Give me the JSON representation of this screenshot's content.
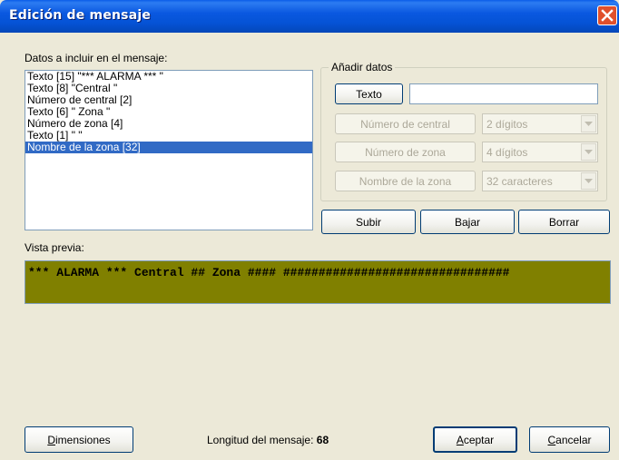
{
  "window": {
    "title": "Edición de mensaje"
  },
  "list": {
    "label": "Datos a incluir en el mensaje:",
    "items": [
      {
        "text": "Texto [15] \"*** ALARMA *** \"",
        "selected": false
      },
      {
        "text": "Texto [8] \"Central \"",
        "selected": false
      },
      {
        "text": "Número de central [2]",
        "selected": false
      },
      {
        "text": "Texto [6] \" Zona \"",
        "selected": false
      },
      {
        "text": "Número de zona [4]",
        "selected": false
      },
      {
        "text": "Texto [1] \" \"",
        "selected": false
      },
      {
        "text": "Nombre de la zona [32]",
        "selected": true
      }
    ]
  },
  "add_data": {
    "title": "Añadir datos",
    "texto_button": "Texto",
    "texto_value": "",
    "central_button": "Número de central",
    "central_combo": "2 dígitos",
    "zona_button": "Número de zona",
    "zona_combo": "4 dígitos",
    "nombre_button": "Nombre de la zona",
    "nombre_combo": "32 caracteres"
  },
  "actions": {
    "subir": "Subir",
    "bajar": "Bajar",
    "borrar": "Borrar"
  },
  "preview": {
    "label": "Vista previa:",
    "text": "*** ALARMA *** Central ## Zona #### ################################",
    "background": "#808000"
  },
  "footer": {
    "dimensiones_first": "D",
    "dimensiones_rest": "imensiones",
    "length_label": "Longitud del mensaje:",
    "length_value": "68",
    "aceptar_first": "A",
    "aceptar_rest": "ceptar",
    "cancelar_first": "C",
    "cancelar_rest": "ancelar"
  },
  "colors": {
    "titlebar": "#0553d6",
    "selection": "#316ac5",
    "close": "#e0502c"
  }
}
